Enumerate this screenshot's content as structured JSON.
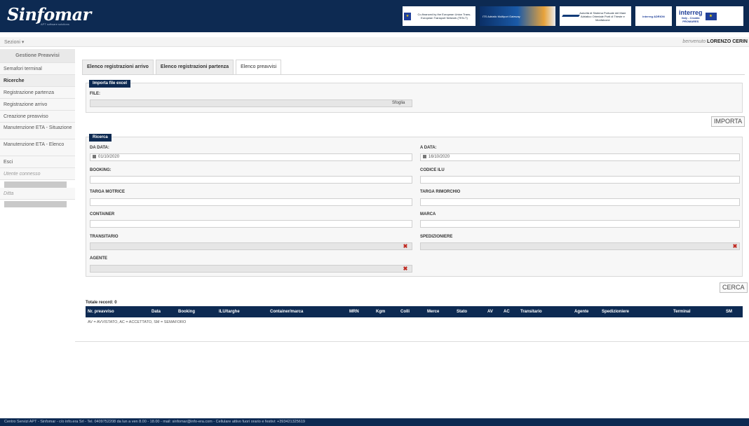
{
  "header": {
    "logo": "Sinfomar",
    "logo_sub": "APT software solutions",
    "partner_logos": [
      {
        "text": "Co-financed by the European Union Trans-European Transport Network (TEN-T)"
      },
      {
        "text": "ITS Adriatic Multiport Gateway"
      },
      {
        "text": "Autorità di Sistema Portuale del Mare Adriatico Orientale Porti di Trieste e Monfalcone"
      },
      {
        "text": "interreg ADRION"
      },
      {
        "text_main": "interreg",
        "text_sub": "Italy - Croatia",
        "text_sub2": "PROMARES"
      }
    ]
  },
  "subbar": {
    "sections_label": "Sezioni ▾",
    "welcome_prefix": "benvenuto",
    "user_name": "LORENZO CERIN"
  },
  "sidebar": {
    "title": "Gestione Preavvisi",
    "items": [
      {
        "label": "Semafori terminal"
      },
      {
        "label": "Ricerche"
      },
      {
        "label": "Registrazione partenza"
      },
      {
        "label": "Registrazione arrivo"
      },
      {
        "label": "Creazione preavviso"
      },
      {
        "label": "Manutenzione ETA - Situazione"
      },
      {
        "label": "Manutenzione ETA - Elenco"
      },
      {
        "label": "Esci"
      },
      {
        "label": "Utente connesso"
      },
      {
        "label": "Ditta"
      }
    ]
  },
  "tabs": [
    {
      "label": "Elenco registrazioni arrivo"
    },
    {
      "label": "Elenco registrazioni partenza"
    },
    {
      "label": "Elenco preavvisi"
    }
  ],
  "import_panel": {
    "legend": "Importa file excel",
    "file_label": "FILE:",
    "browse_label": "Sfoglia",
    "import_button": "IMPORTA"
  },
  "search_panel": {
    "legend": "Ricerca",
    "da_data_label": "DA DATA:",
    "da_data_value": "01/10/2020",
    "a_data_label": "A DATA:",
    "a_data_value": "16/10/2020",
    "booking_label": "BOOKING:",
    "codice_ilu_label": "CODICE ILU",
    "targa_motrice_label": "TARGA MOTRICE",
    "targa_rimorchio_label": "TARGA RIMORCHIO",
    "container_label": "CONTAINER",
    "marca_label": "MARCA",
    "transitario_label": "TRANSITARIO",
    "spedizioniere_label": "SPEDIZIONIERE",
    "agente_label": "AGENTE",
    "clear_glyph": "✖",
    "search_button": "CERCA"
  },
  "results": {
    "total_label": "Totale record: 0",
    "columns": [
      "Nr. preavviso",
      "Data",
      "Booking",
      "ILU/targhe",
      "Container/marca",
      "MRN",
      "Kgm",
      "Colli",
      "Merce",
      "Stato",
      "AV",
      "AC",
      "Transitario",
      "Agente",
      "Spedizioniere",
      "Terminal",
      "SM"
    ],
    "legend_note": "AV = AVVISTATO, AC = ACCETTATO, SM = SEMAFORO"
  },
  "footer": {
    "text": "Centro Servizi APT - Sinfomar - c/o info.era Srl - Tel. 0409752208 da lun a ven 8.00 - 18.00 - mail: sinfomar@info-era.com - Cellulare attivo fuori orario e festivi: +393421325619"
  },
  "colors": {
    "brand_navy": "#0d2a52",
    "clear_red": "#c0281f"
  }
}
